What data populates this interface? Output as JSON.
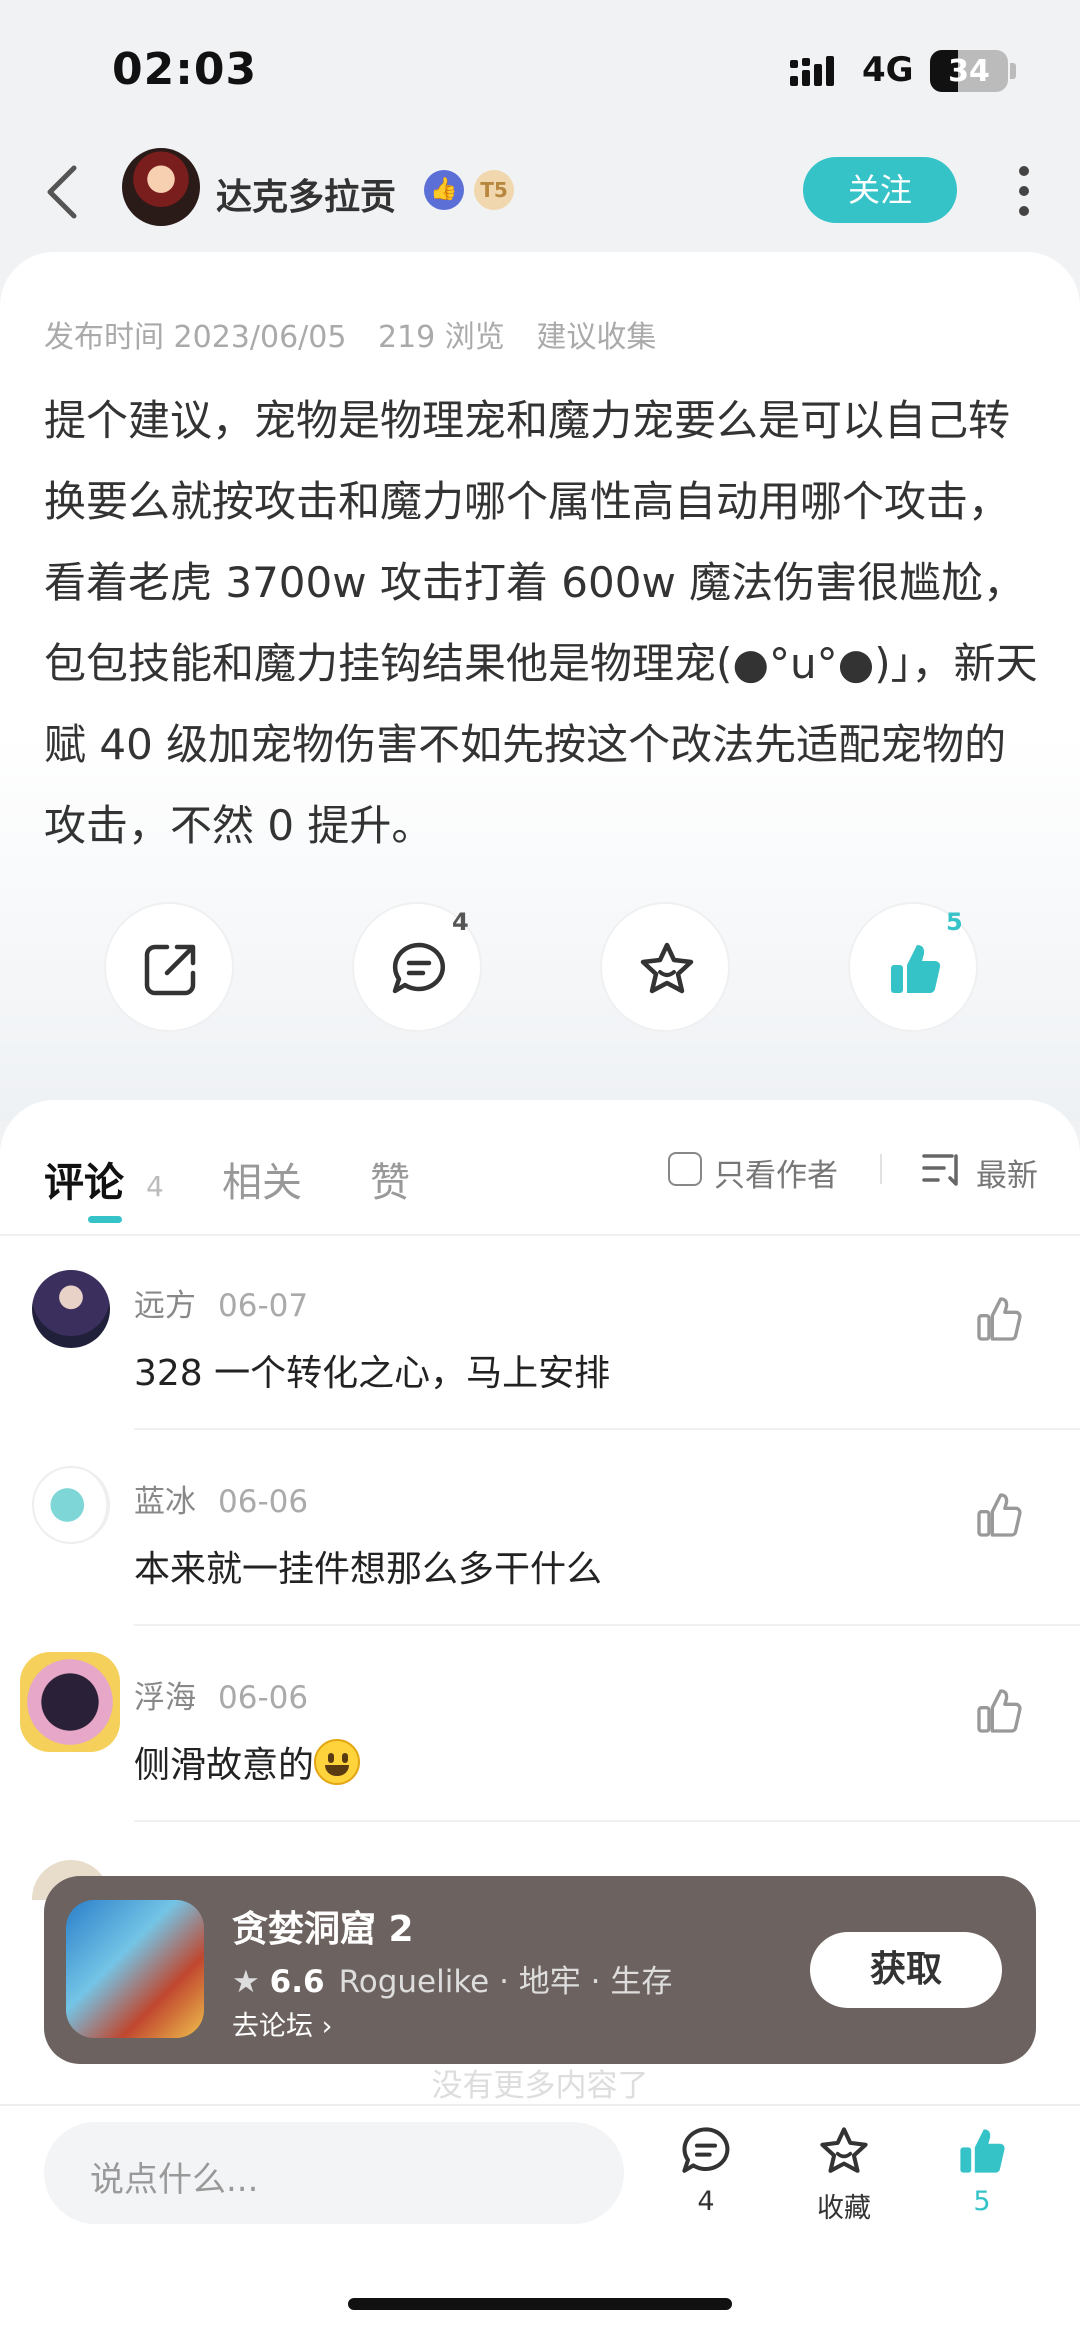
{
  "status_bar": {
    "time": "02:03",
    "network": "4G",
    "battery": "34"
  },
  "header": {
    "author_name": "达克多拉贡",
    "level_badge": "T5",
    "follow_label": "关注"
  },
  "post": {
    "publish_time": "发布时间 2023/06/05",
    "views": "219 浏览",
    "category": "建议收集",
    "body": "提个建议，宠物是物理宠和魔力宠要么是可以自己转换要么就按攻击和魔力哪个属性高自动用哪个攻击，看着老虎 3700w 攻击打着 600w 魔法伤害很尴尬，包包技能和魔力挂钩结果他是物理宠(●°u°●)」，新天赋 40 级加宠物伤害不如先按这个改法先适配宠物的攻击，不然 0 提升。",
    "actions": {
      "share_icon": "share-icon",
      "comment_count": "4",
      "favorite_icon": "star-icon",
      "like_count": "5"
    }
  },
  "comments_section": {
    "tabs": [
      {
        "label": "评论",
        "count": "4"
      },
      {
        "label": "相关"
      },
      {
        "label": "赞"
      }
    ],
    "author_only_label": "只看作者",
    "sort_label": "最新",
    "comments": [
      {
        "user": "远方",
        "date": "06-07",
        "text": "328 一个转化之心，马上安排"
      },
      {
        "user": "蓝冰",
        "date": "06-06",
        "text": "本来就一挂件想那么多干什么"
      },
      {
        "user": "浮海",
        "date": "06-06",
        "text": "侧滑故意的"
      }
    ],
    "no_more": "没有更多内容了"
  },
  "game_banner": {
    "title": "贪婪洞窟 2",
    "rating": "6.6",
    "tags": "Roguelike · 地牢 · 生存",
    "forum_link": "去论坛",
    "get_label": "获取"
  },
  "bottom_bar": {
    "input_placeholder": "说点什么...",
    "comment_count": "4",
    "favorite_label": "收藏",
    "like_count": "5"
  },
  "colors": {
    "accent": "#35c3c8",
    "banner_bg": "#6c625f"
  }
}
